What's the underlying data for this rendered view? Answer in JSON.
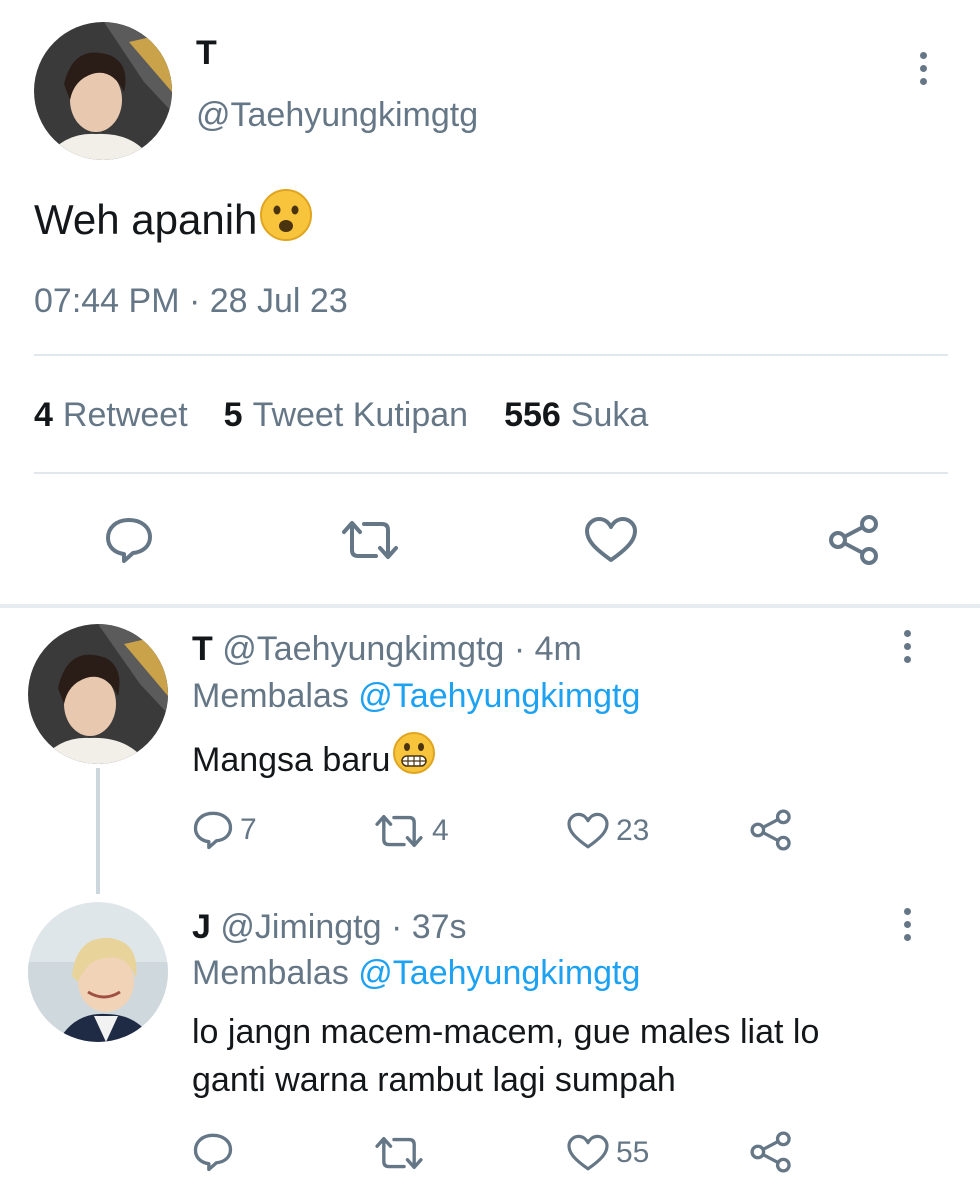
{
  "main_tweet": {
    "author_name": "T",
    "author_handle": "@Taehyungkimgtg",
    "text": "Weh apanih",
    "emoji": "frowning-face-emoji",
    "timestamp": "07:44 PM · 28 Jul 23",
    "stats": {
      "retweets_count": "4",
      "retweets_label": "Retweet",
      "quotes_count": "5",
      "quotes_label": "Tweet Kutipan",
      "likes_count": "556",
      "likes_label": "Suka"
    },
    "actions": [
      "reply-icon",
      "retweet-icon",
      "like-icon",
      "share-icon"
    ]
  },
  "replies": [
    {
      "author_name": "T",
      "author_handle": "@Taehyungkimgtg",
      "time": "· 4m",
      "replying_prefix": "Membalas",
      "replying_to": "@Taehyungkimgtg",
      "text": "Mangsa baru",
      "emoji": "grimacing-face-emoji",
      "reply_count": "7",
      "retweet_count": "4",
      "like_count": "23"
    },
    {
      "author_name": "J",
      "author_handle": "@Jimingtg",
      "time": "· 37s",
      "replying_prefix": "Membalas",
      "replying_to": "@Taehyungkimgtg",
      "text_line1": "lo jangn macem-macem, gue males liat lo",
      "text_line2": "ganti warna rambut lagi sumpah",
      "reply_count": "",
      "retweet_count": "",
      "like_count": "55"
    }
  ],
  "colors": {
    "text": "#14171a",
    "muted": "#657786",
    "link": "#1da1f2",
    "divider": "#e1e8ed"
  }
}
